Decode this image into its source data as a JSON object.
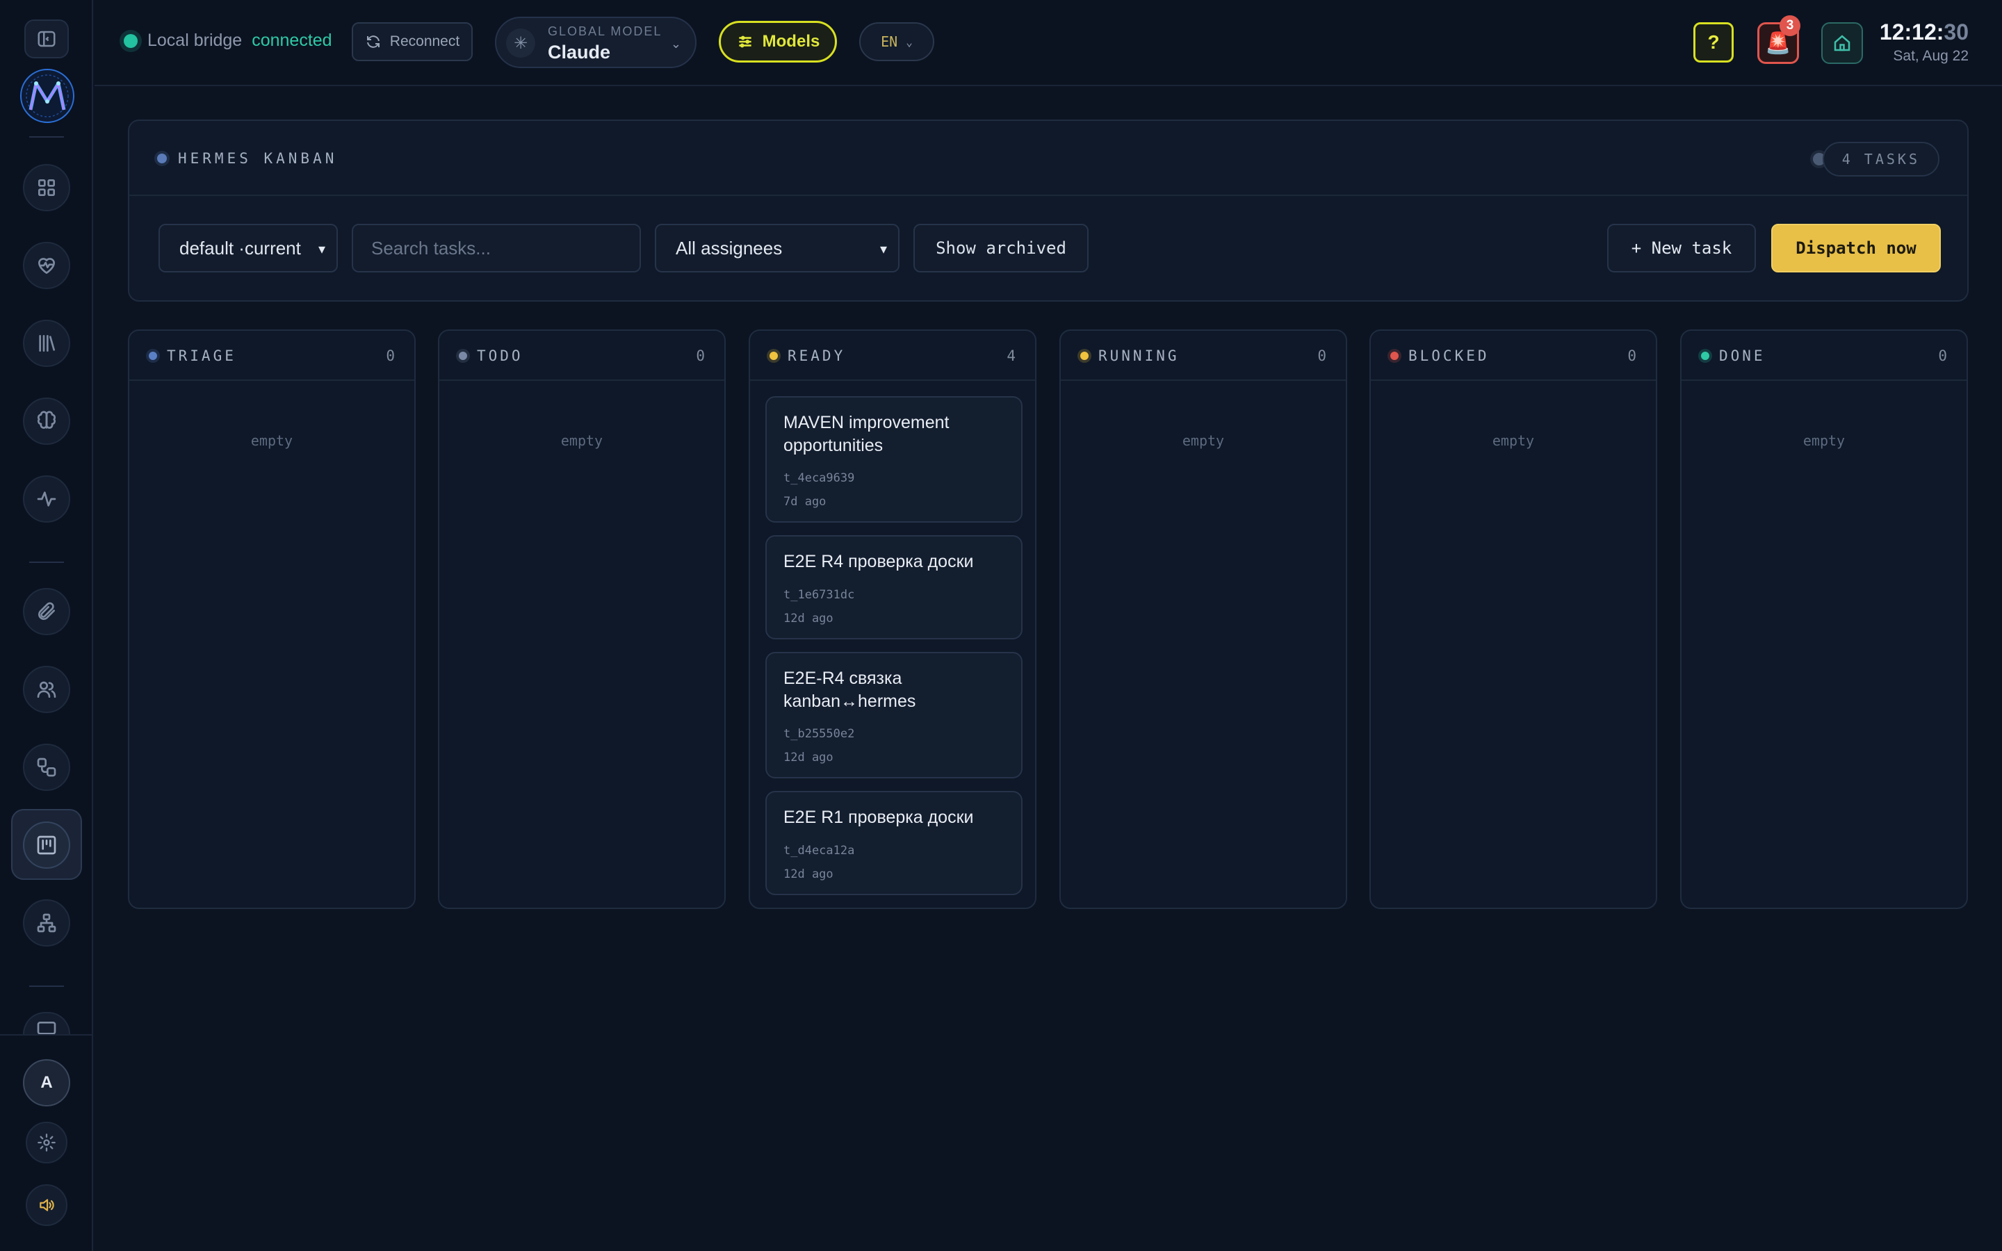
{
  "topbar": {
    "bridge_label": "Local bridge",
    "bridge_status": "connected",
    "reconnect_label": "Reconnect",
    "model_caption": "GLOBAL MODEL",
    "model_name": "Claude",
    "models_label": "Models",
    "lang_label": "EN",
    "help_label": "?",
    "alert_count": "3",
    "clock_hm": "12:12:",
    "clock_sec": "30",
    "clock_date": "Sat, Aug 22"
  },
  "sidebar": {
    "avatar_letter": "A",
    "items": [
      "panel-toggle",
      "dashboard",
      "health",
      "library",
      "brain",
      "activity",
      "attachments",
      "people",
      "workflow",
      "kanban",
      "org-chart",
      "monitor"
    ]
  },
  "board": {
    "title": "HERMES KANBAN",
    "task_count": "4 TASKS",
    "board_select": "default ·current",
    "search_placeholder": "Search tasks...",
    "assignee_select": "All assignees",
    "archived_label": "Show archived",
    "new_task_label": "+ New task",
    "dispatch_label": "Dispatch now"
  },
  "columns": [
    {
      "name": "TRIAGE",
      "count": "0",
      "color": "#5b7fc4",
      "empty_label": "empty"
    },
    {
      "name": "TODO",
      "count": "0",
      "color": "#7a8aa6",
      "empty_label": "empty"
    },
    {
      "name": "READY",
      "count": "4",
      "color": "#f0c23e",
      "empty_label": ""
    },
    {
      "name": "RUNNING",
      "count": "0",
      "color": "#f0c23e",
      "empty_label": "empty"
    },
    {
      "name": "BLOCKED",
      "count": "0",
      "color": "#e0554d",
      "empty_label": "empty"
    },
    {
      "name": "DONE",
      "count": "0",
      "color": "#2fc9a6",
      "empty_label": "empty"
    }
  ],
  "cards": [
    {
      "title": "MAVEN improvement opportunities",
      "id": "t_4eca9639",
      "age": "7d ago"
    },
    {
      "title": "E2E R4 проверка доски",
      "id": "t_1e6731dc",
      "age": "12d ago"
    },
    {
      "title": "E2E-R4 связка kanban↔hermes",
      "id": "t_b25550e2",
      "age": "12d ago"
    },
    {
      "title": "E2E R1 проверка доски",
      "id": "t_d4eca12a",
      "age": "12d ago"
    }
  ]
}
